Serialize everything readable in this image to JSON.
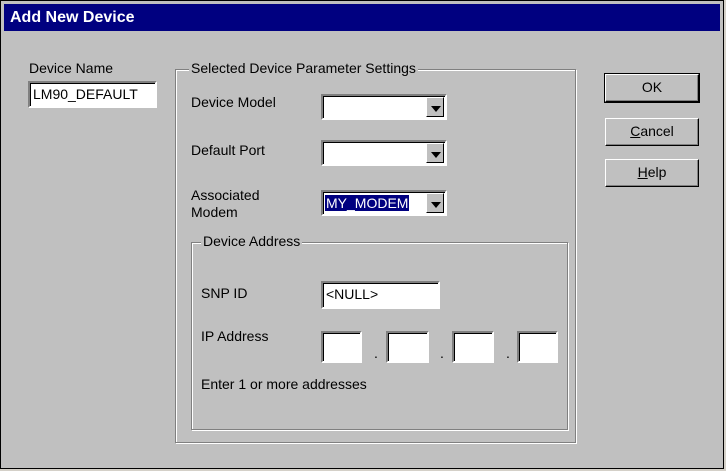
{
  "window": {
    "title": "Add New Device"
  },
  "device_name": {
    "label": "Device Name",
    "value": "LM90_DEFAULT"
  },
  "params_group": {
    "title": "Selected Device Parameter Settings"
  },
  "device_model": {
    "label": "Device Model",
    "value": ""
  },
  "default_port": {
    "label": "Default Port",
    "value": ""
  },
  "associated_modem": {
    "label_line1": "Associated",
    "label_line2": "Modem",
    "value": "MY_MODEM"
  },
  "address_group": {
    "title": "Device Address"
  },
  "snp_id": {
    "label": "SNP ID",
    "value": "<NULL>"
  },
  "ip_address": {
    "label": "IP Address",
    "octets": [
      "",
      "",
      "",
      ""
    ],
    "separator": "."
  },
  "hint": "Enter 1 or more addresses",
  "buttons": {
    "ok": "OK",
    "cancel_prefix": "C",
    "cancel_rest": "ancel",
    "help_prefix": "H",
    "help_rest": "elp"
  }
}
